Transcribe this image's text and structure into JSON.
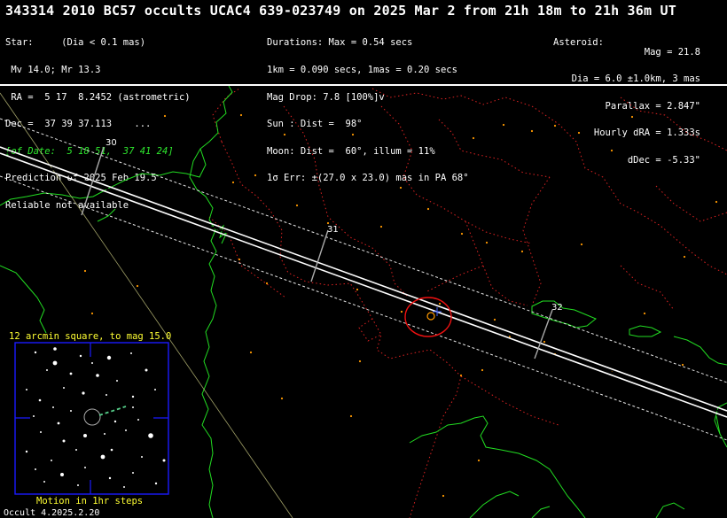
{
  "title": "343314 2010 BC57 occults UCAC4 639-023749 on 2025 Mar  2 from 21h 18m to 21h 36m UT",
  "star": {
    "lines": [
      "Star:     (Dia < 0.1 mas)",
      " Mv 14.0; Mr 13.3",
      " RA =  5 17  8.2452 (astrometric)",
      "Dec =  37 39 37.113    ...",
      "[of Date:  5 18 51,  37 41 24]",
      "Prediction of 2025 Feb 19.5",
      "Reliable not available"
    ]
  },
  "event": {
    "lines": [
      "Durations: Max = 0.54 secs",
      "1km = 0.090 secs, 1mas = 0.20 secs",
      "Mag Drop: 7.8 [100%]v",
      "Sun : Dist =  98°",
      "Moon: Dist =  60°, illum = 11%",
      "1σ Err: ±(27.0 x 23.0) mas in PA 68°"
    ]
  },
  "asteroid": {
    "lines": [
      "Asteroid:",
      "Mag = 21.8",
      "Dia = 6.0 ±1.0km, 3 mas",
      "Parallax = 2.847\"",
      "Hourly dRA = 1.333s",
      "dDec = -5.33\""
    ]
  },
  "map": {
    "track_minutes": [
      "30",
      "31",
      "32"
    ],
    "colors": {
      "coast": "#22dd22",
      "borders": "#dd2222",
      "path": "#ffffff",
      "error_ellipse": "#ee1111",
      "star_points": "#ff9900",
      "inset_frame": "#1a1aff",
      "inset_text": "#ffff33"
    }
  },
  "inset": {
    "title": "12 arcmin square, to mag 15.0",
    "footer": "Motion in 1hr steps"
  },
  "footer": "Occult 4.2025.2.20"
}
